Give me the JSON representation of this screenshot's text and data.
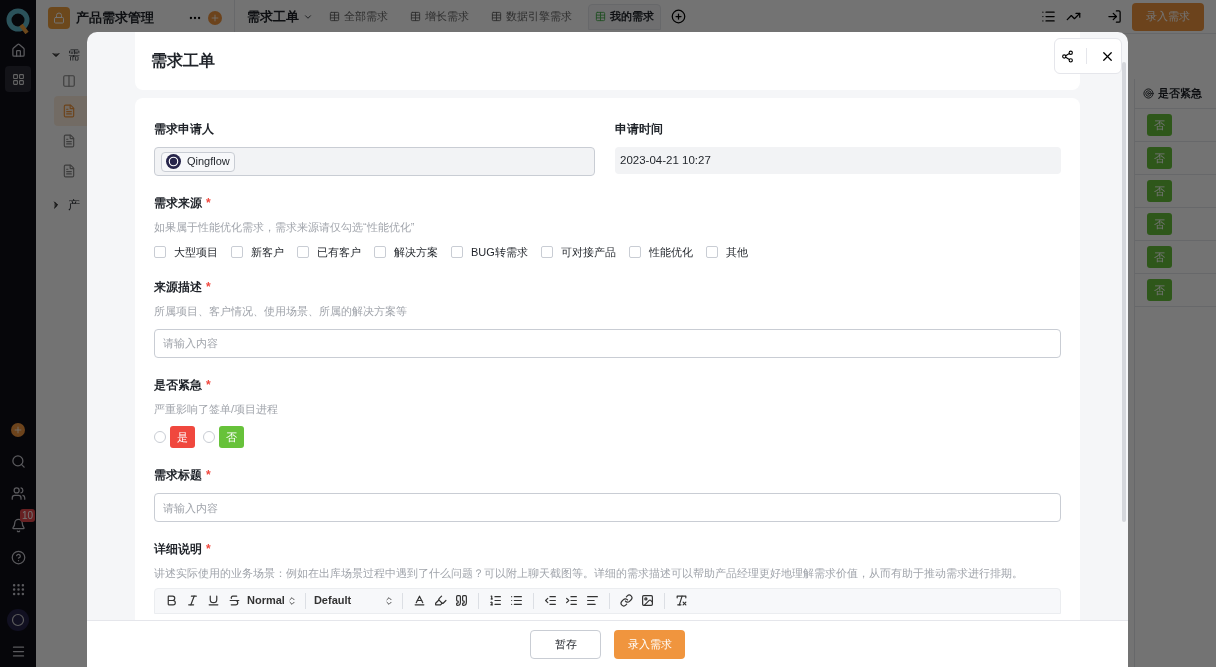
{
  "nav_rail": {
    "notification_badge": "10"
  },
  "sidebar": {
    "app_name": "产品需求管理",
    "groups": [
      {
        "label": "需",
        "expanded": true,
        "items": [
          {
            "kind": "board",
            "selected": false
          },
          {
            "kind": "form",
            "selected": true
          },
          {
            "kind": "form",
            "selected": false
          },
          {
            "kind": "form",
            "selected": false
          }
        ]
      },
      {
        "label": "产",
        "expanded": false
      }
    ]
  },
  "view_menu": {
    "label": "需求工单"
  },
  "tabs": [
    {
      "label": "全部需求",
      "selected": false
    },
    {
      "label": "增长需求",
      "selected": false
    },
    {
      "label": "数据引擎需求",
      "selected": false
    },
    {
      "label": "我的需求",
      "selected": true
    }
  ],
  "top_actions": {
    "primary": "录入需求"
  },
  "table": {
    "column": "是否紧急",
    "cells": [
      {
        "text": "否"
      },
      {
        "text": "否"
      },
      {
        "text": "否"
      },
      {
        "text": "否"
      },
      {
        "text": "否"
      },
      {
        "text": "否"
      }
    ]
  },
  "modal": {
    "title": "需求工单",
    "rows": [
      [
        {
          "kind": "member",
          "label": "需求申请人",
          "value": "Qingflow"
        },
        {
          "kind": "datetime",
          "label": "申请时间",
          "value": "2023-04-21 10:27"
        }
      ],
      [
        {
          "kind": "checkbox",
          "label": "需求来源",
          "required_mark": "*",
          "hint": "如果属于性能优化需求，需求来源请仅勾选“性能优化”",
          "options": [
            {
              "label": "大型项目",
              "checked": false
            },
            {
              "label": "新客户",
              "checked": false
            },
            {
              "label": "已有客户",
              "checked": false
            },
            {
              "label": "解决方案",
              "checked": false
            },
            {
              "label": "BUG转需求",
              "checked": false
            },
            {
              "label": "可对接产品",
              "checked": false
            },
            {
              "label": "性能优化",
              "checked": false
            },
            {
              "label": "其他",
              "checked": false
            }
          ]
        }
      ],
      [
        {
          "kind": "text",
          "label": "来源描述",
          "required_mark": "*",
          "hint": "所属项目、客户情况、使用场景、所属的解决方案等",
          "placeholder": "请输入内容"
        }
      ],
      [
        {
          "kind": "radio",
          "label": "是否紧急",
          "required_mark": "*",
          "hint": "严重影响了签单/项目进程",
          "options": [
            {
              "label": "是",
              "color": "#f0483e",
              "selected": false
            },
            {
              "label": "否",
              "color": "#67c23a",
              "selected": false
            }
          ]
        }
      ],
      [
        {
          "kind": "text",
          "label": "需求标题",
          "required_mark": "*",
          "placeholder": "请输入内容"
        }
      ],
      [
        {
          "kind": "richtext",
          "label": "详细说明",
          "required_mark": "*",
          "hint": "讲述实际使用的业务场景：例如在出库场景过程中遇到了什么问题？可以附上聊天截图等。详细的需求描述可以帮助产品经理更好地理解需求价值，从而有助于推动需求进行排期。",
          "header": "Normal",
          "font": "Default"
        }
      ]
    ],
    "buttons": [
      {
        "label": "暂存",
        "kind": "secondary"
      },
      {
        "label": "录入需求",
        "kind": "primary"
      }
    ]
  }
}
